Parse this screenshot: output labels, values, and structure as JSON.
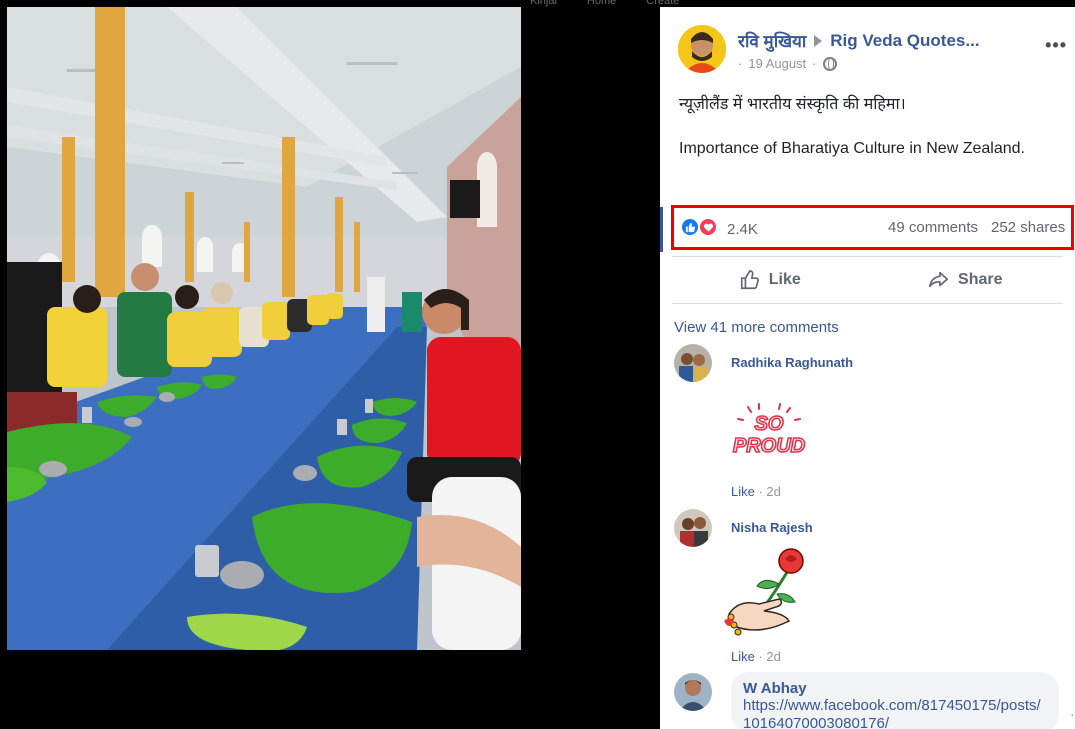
{
  "top_nav": [
    "Kinjal",
    "Home",
    "Create"
  ],
  "post": {
    "author": "रवि मुखिया",
    "group": "Rig Veda Quotes...",
    "date": "19 August",
    "text_hindi": "न्यूज़ीलैंड में भारतीय संस्कृति की महिमा।",
    "text_english": "Importance of Bharatiya Culture in New Zealand.",
    "reactions": {
      "count": "2.4K",
      "icons": [
        "like-icon",
        "love-icon"
      ]
    },
    "comments_count": "49 comments",
    "shares_count": "252 shares",
    "highlight_color": "#ed0000"
  },
  "actions": {
    "like": "Like",
    "share": "Share"
  },
  "view_more": "View 41 more comments",
  "comments": [
    {
      "name": "Radhika Raghunath",
      "sticker": "SO PROUD",
      "like_label": "Like",
      "age": "2d"
    },
    {
      "name": "Nisha Rajesh",
      "sticker": "hand-with-rose",
      "like_label": "Like",
      "age": "2d"
    },
    {
      "name": "W Abhay",
      "link_line1": "https://www.facebook.com/817450175/post",
      "link_line2": "s/10164070003080176/"
    }
  ],
  "colors": {
    "link": "#385898",
    "muted": "#90949c",
    "like_blue": "#1877f2",
    "love_red": "#f33e58"
  }
}
